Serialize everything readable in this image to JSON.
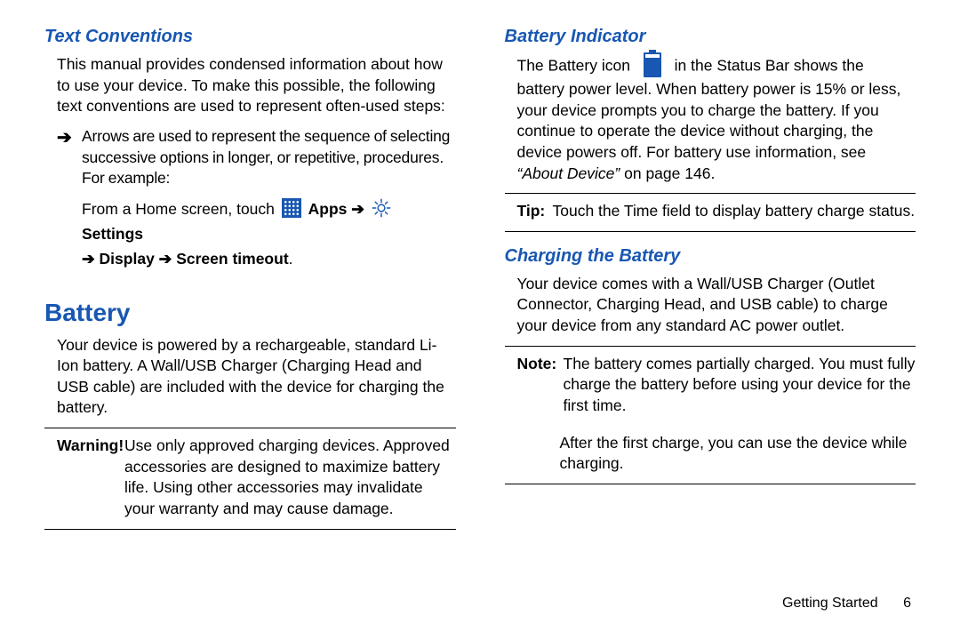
{
  "left": {
    "h_text_conventions": "Text Conventions",
    "text_conv_para": "This manual provides condensed information about how to use your device. To make this possible, the following text conventions are used to represent often-used steps:",
    "arrow_bullet": "Arrows are used to represent the sequence of selecting successive options in longer, or repetitive, procedures. For example:",
    "from_pre": "From a Home screen, touch ",
    "apps_label": "Apps",
    "settings_label": "Settings",
    "display_label": "Display",
    "screen_timeout_label": "Screen timeout",
    "arrow_glyph": "➔",
    "h_battery": "Battery",
    "battery_para": "Your device is powered by a rechargeable, standard Li-Ion battery. A Wall/USB Charger (Charging Head and USB cable) are included with the device for charging the battery.",
    "warning_label": "Warning!",
    "warning_text": "Use only approved charging devices. Approved accessories are designed to maximize battery life. Using other accessories may invalidate your warranty and may cause damage."
  },
  "right": {
    "h_battery_indicator": "Battery Indicator",
    "bi_pre": "The Battery icon ",
    "bi_post1": " in the Status Bar shows the battery power level. When battery power is 15% or less, your device prompts you to charge the battery. If you continue to operate the device without charging, the device powers off. For battery use information, see ",
    "bi_ref": "“About Device”",
    "bi_post2": " on page 146.",
    "tip_label": "Tip:",
    "tip_text": " Touch the Time field to display battery charge status.",
    "h_charging": "Charging the Battery",
    "charging_para": "Your device comes with a Wall/USB Charger (Outlet Connector, Charging Head, and USB cable) to charge your device from any standard AC power outlet.",
    "note_label": "Note:",
    "note_text": " The battery comes partially charged. You must fully charge the battery before using your device for the first time.",
    "after_note": "After the first charge, you can use the device while charging."
  },
  "footer": {
    "section": "Getting Started",
    "page": "6"
  }
}
